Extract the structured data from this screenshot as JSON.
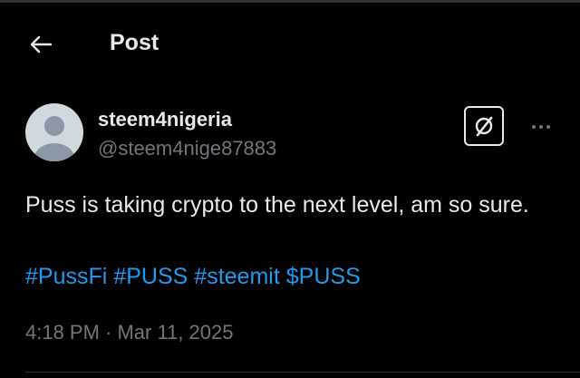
{
  "header": {
    "title": "Post",
    "back_icon": "arrow-left-icon"
  },
  "author": {
    "display_name": "steem4nigeria",
    "handle": "@steem4nige87883",
    "avatar_icon": "default-avatar-icon"
  },
  "actions": {
    "grok_icon": "grok-slash-icon",
    "more_icon": "more-horizontal-icon"
  },
  "post": {
    "text": "Puss is taking crypto to the next level, am so sure.",
    "hashtags": [
      "#PussFi",
      "#PUSS",
      "#steemit",
      "$PUSS"
    ],
    "timestamp": "4:18 PM · Mar 11, 2025"
  },
  "colors": {
    "background": "#000000",
    "text": "#e7e9ea",
    "muted": "#71767b",
    "link": "#1d9bf0",
    "avatar": "#cfd9de"
  }
}
